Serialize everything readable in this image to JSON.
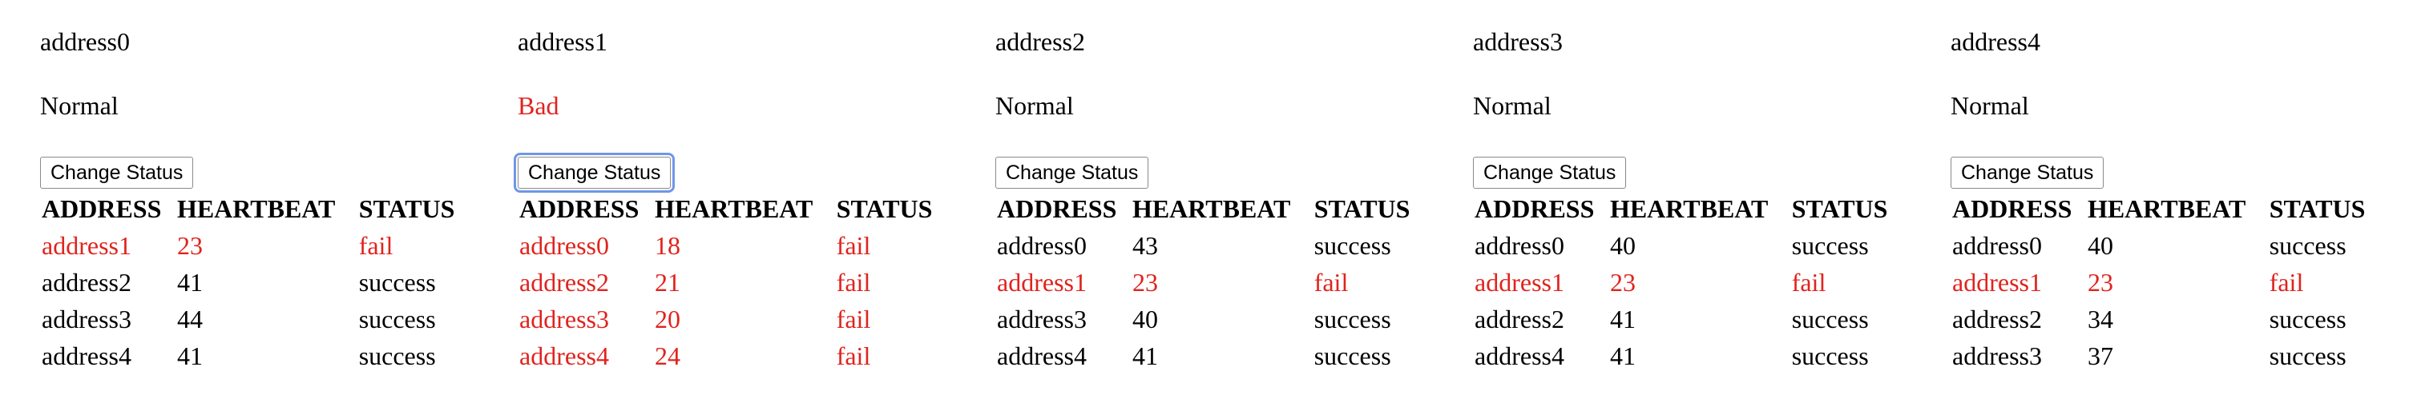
{
  "colors": {
    "fail": "#e0231d",
    "normal": "#000000",
    "focus_ring": "#6f97e7"
  },
  "table_headers": {
    "address": "ADDRESS",
    "heartbeat": "HEARTBEAT",
    "status": "STATUS"
  },
  "nodes": [
    {
      "name": "address0",
      "status": "Normal",
      "button_label": "Change Status",
      "peers": [
        {
          "address": "address1",
          "heartbeat": "23",
          "status": "fail"
        },
        {
          "address": "address2",
          "heartbeat": "41",
          "status": "success"
        },
        {
          "address": "address3",
          "heartbeat": "44",
          "status": "success"
        },
        {
          "address": "address4",
          "heartbeat": "41",
          "status": "success"
        }
      ]
    },
    {
      "name": "address1",
      "status": "Bad",
      "button_label": "Change Status",
      "peers": [
        {
          "address": "address0",
          "heartbeat": "18",
          "status": "fail"
        },
        {
          "address": "address2",
          "heartbeat": "21",
          "status": "fail"
        },
        {
          "address": "address3",
          "heartbeat": "20",
          "status": "fail"
        },
        {
          "address": "address4",
          "heartbeat": "24",
          "status": "fail"
        }
      ]
    },
    {
      "name": "address2",
      "status": "Normal",
      "button_label": "Change Status",
      "peers": [
        {
          "address": "address0",
          "heartbeat": "43",
          "status": "success"
        },
        {
          "address": "address1",
          "heartbeat": "23",
          "status": "fail"
        },
        {
          "address": "address3",
          "heartbeat": "40",
          "status": "success"
        },
        {
          "address": "address4",
          "heartbeat": "41",
          "status": "success"
        }
      ]
    },
    {
      "name": "address3",
      "status": "Normal",
      "button_label": "Change Status",
      "peers": [
        {
          "address": "address0",
          "heartbeat": "40",
          "status": "success"
        },
        {
          "address": "address1",
          "heartbeat": "23",
          "status": "fail"
        },
        {
          "address": "address2",
          "heartbeat": "41",
          "status": "success"
        },
        {
          "address": "address4",
          "heartbeat": "41",
          "status": "success"
        }
      ]
    },
    {
      "name": "address4",
      "status": "Normal",
      "button_label": "Change Status",
      "peers": [
        {
          "address": "address0",
          "heartbeat": "40",
          "status": "success"
        },
        {
          "address": "address1",
          "heartbeat": "23",
          "status": "fail"
        },
        {
          "address": "address2",
          "heartbeat": "34",
          "status": "success"
        },
        {
          "address": "address3",
          "heartbeat": "37",
          "status": "success"
        }
      ]
    }
  ]
}
